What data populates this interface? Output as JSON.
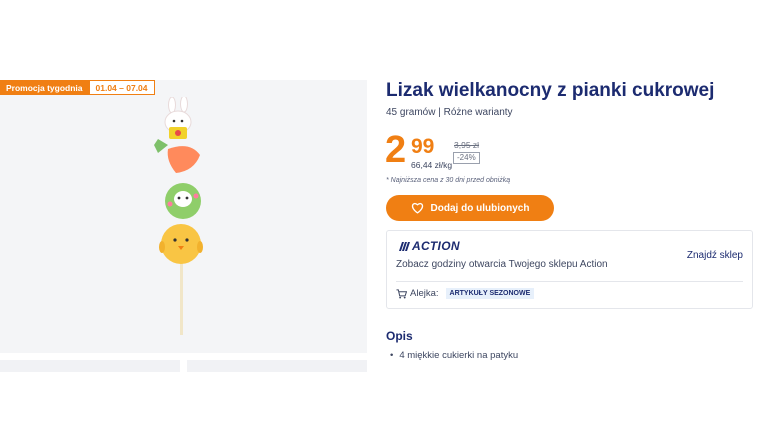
{
  "promo": {
    "label": "Promocja tygodnia",
    "dates": "01.04 – 07.04"
  },
  "product": {
    "title": "Lizak wielkanocny z pianki cukrowej",
    "subtitle": "45 gramów | Różne warianty"
  },
  "price": {
    "integer": "2",
    "decimal": "99",
    "unit_price": "66,44 zł/kg",
    "old_price": "3,95 zł",
    "discount": "-24%",
    "footnote": "* Najniższa cena z 30 dni przed obniżką"
  },
  "favorite_button": {
    "label": "Dodaj do ulubionych",
    "icon": "heart-icon"
  },
  "store": {
    "brand": "ACTION",
    "hours_text": "Zobacz godziny otwarcia Twojego sklepu Action",
    "find_store": "Znajdź sklep",
    "aisle_label": "Alejka:",
    "aisle_value": "ARTYKUŁY SEZONOWE",
    "aisle_icon": "cart-icon"
  },
  "description": {
    "heading": "Opis",
    "items": [
      "4 miękkie cukierki na patyku"
    ]
  },
  "colors": {
    "accent": "#f07f13",
    "navy": "#1c2b70"
  }
}
